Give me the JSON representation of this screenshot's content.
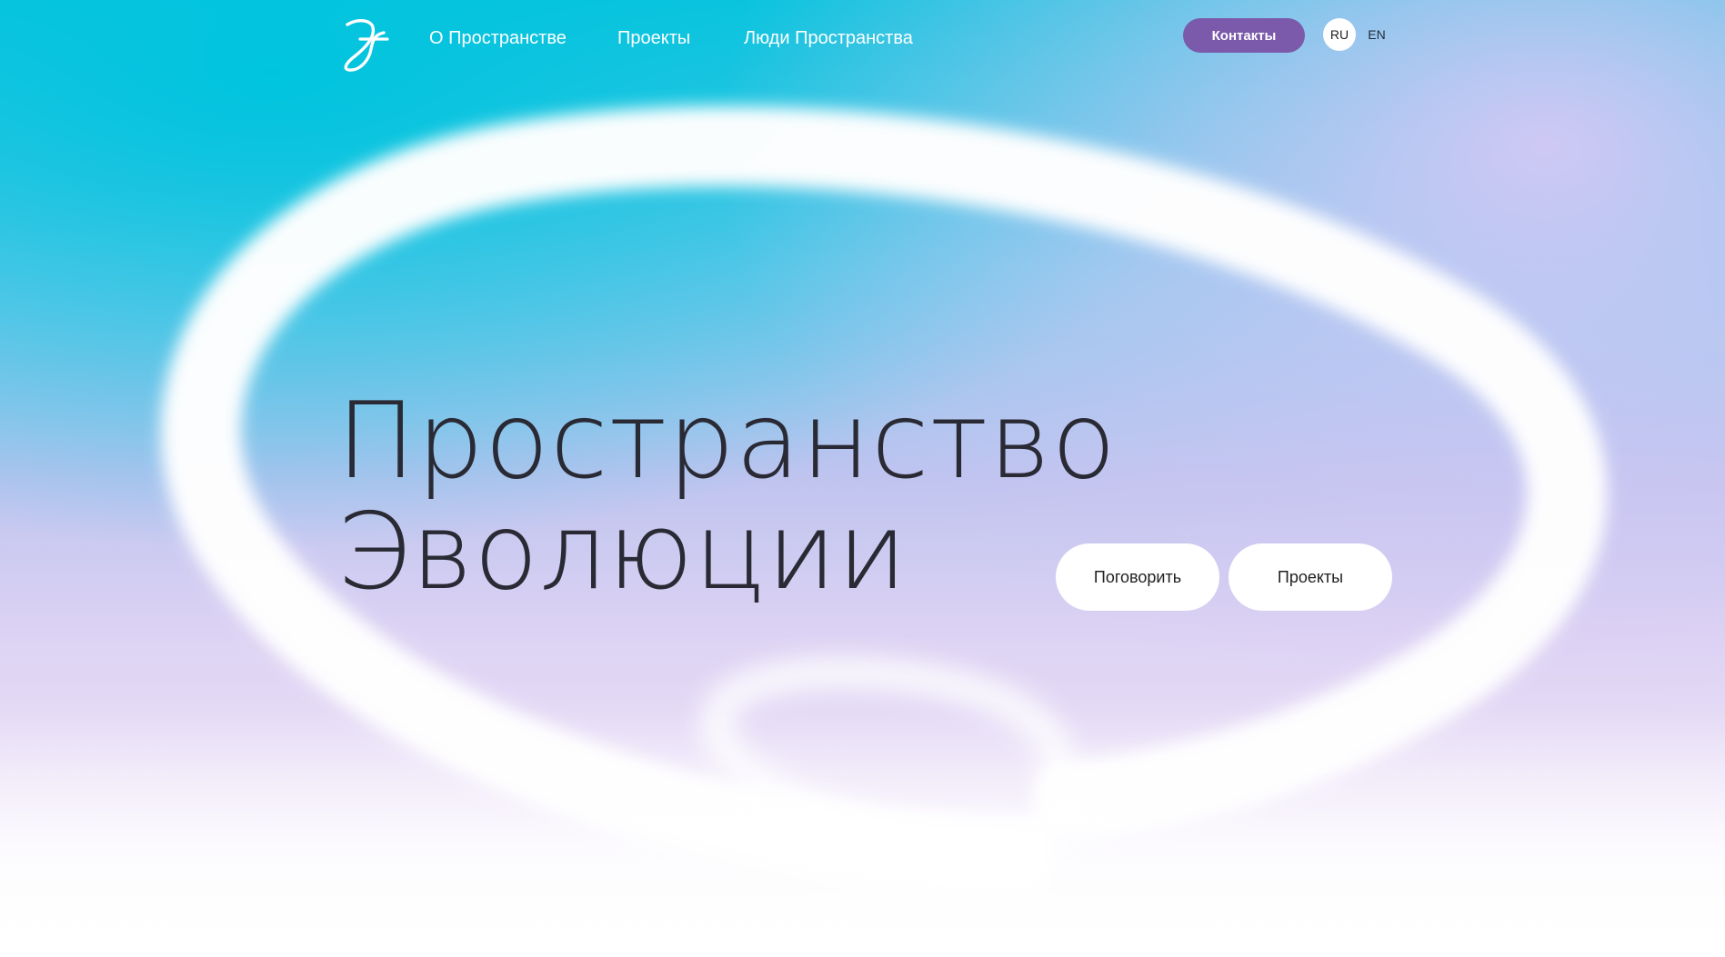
{
  "header": {
    "logo_icon": "evolution-swirl-logo-icon",
    "nav": [
      {
        "label": "О Пространстве"
      },
      {
        "label": "Проекты"
      },
      {
        "label": "Люди Пространства"
      }
    ],
    "contacts_label": "Контакты",
    "lang": {
      "active": "RU",
      "other": "EN"
    }
  },
  "hero": {
    "title_line1": "Пространство",
    "title_line2": "Эволюции",
    "buttons": {
      "talk": "Поговорить",
      "projects": "Проекты"
    }
  },
  "colors": {
    "accent": "#7b5aab",
    "cyan": "#00c4de",
    "lavender": "#dcd2f3",
    "text_dark": "#2a2a35"
  }
}
